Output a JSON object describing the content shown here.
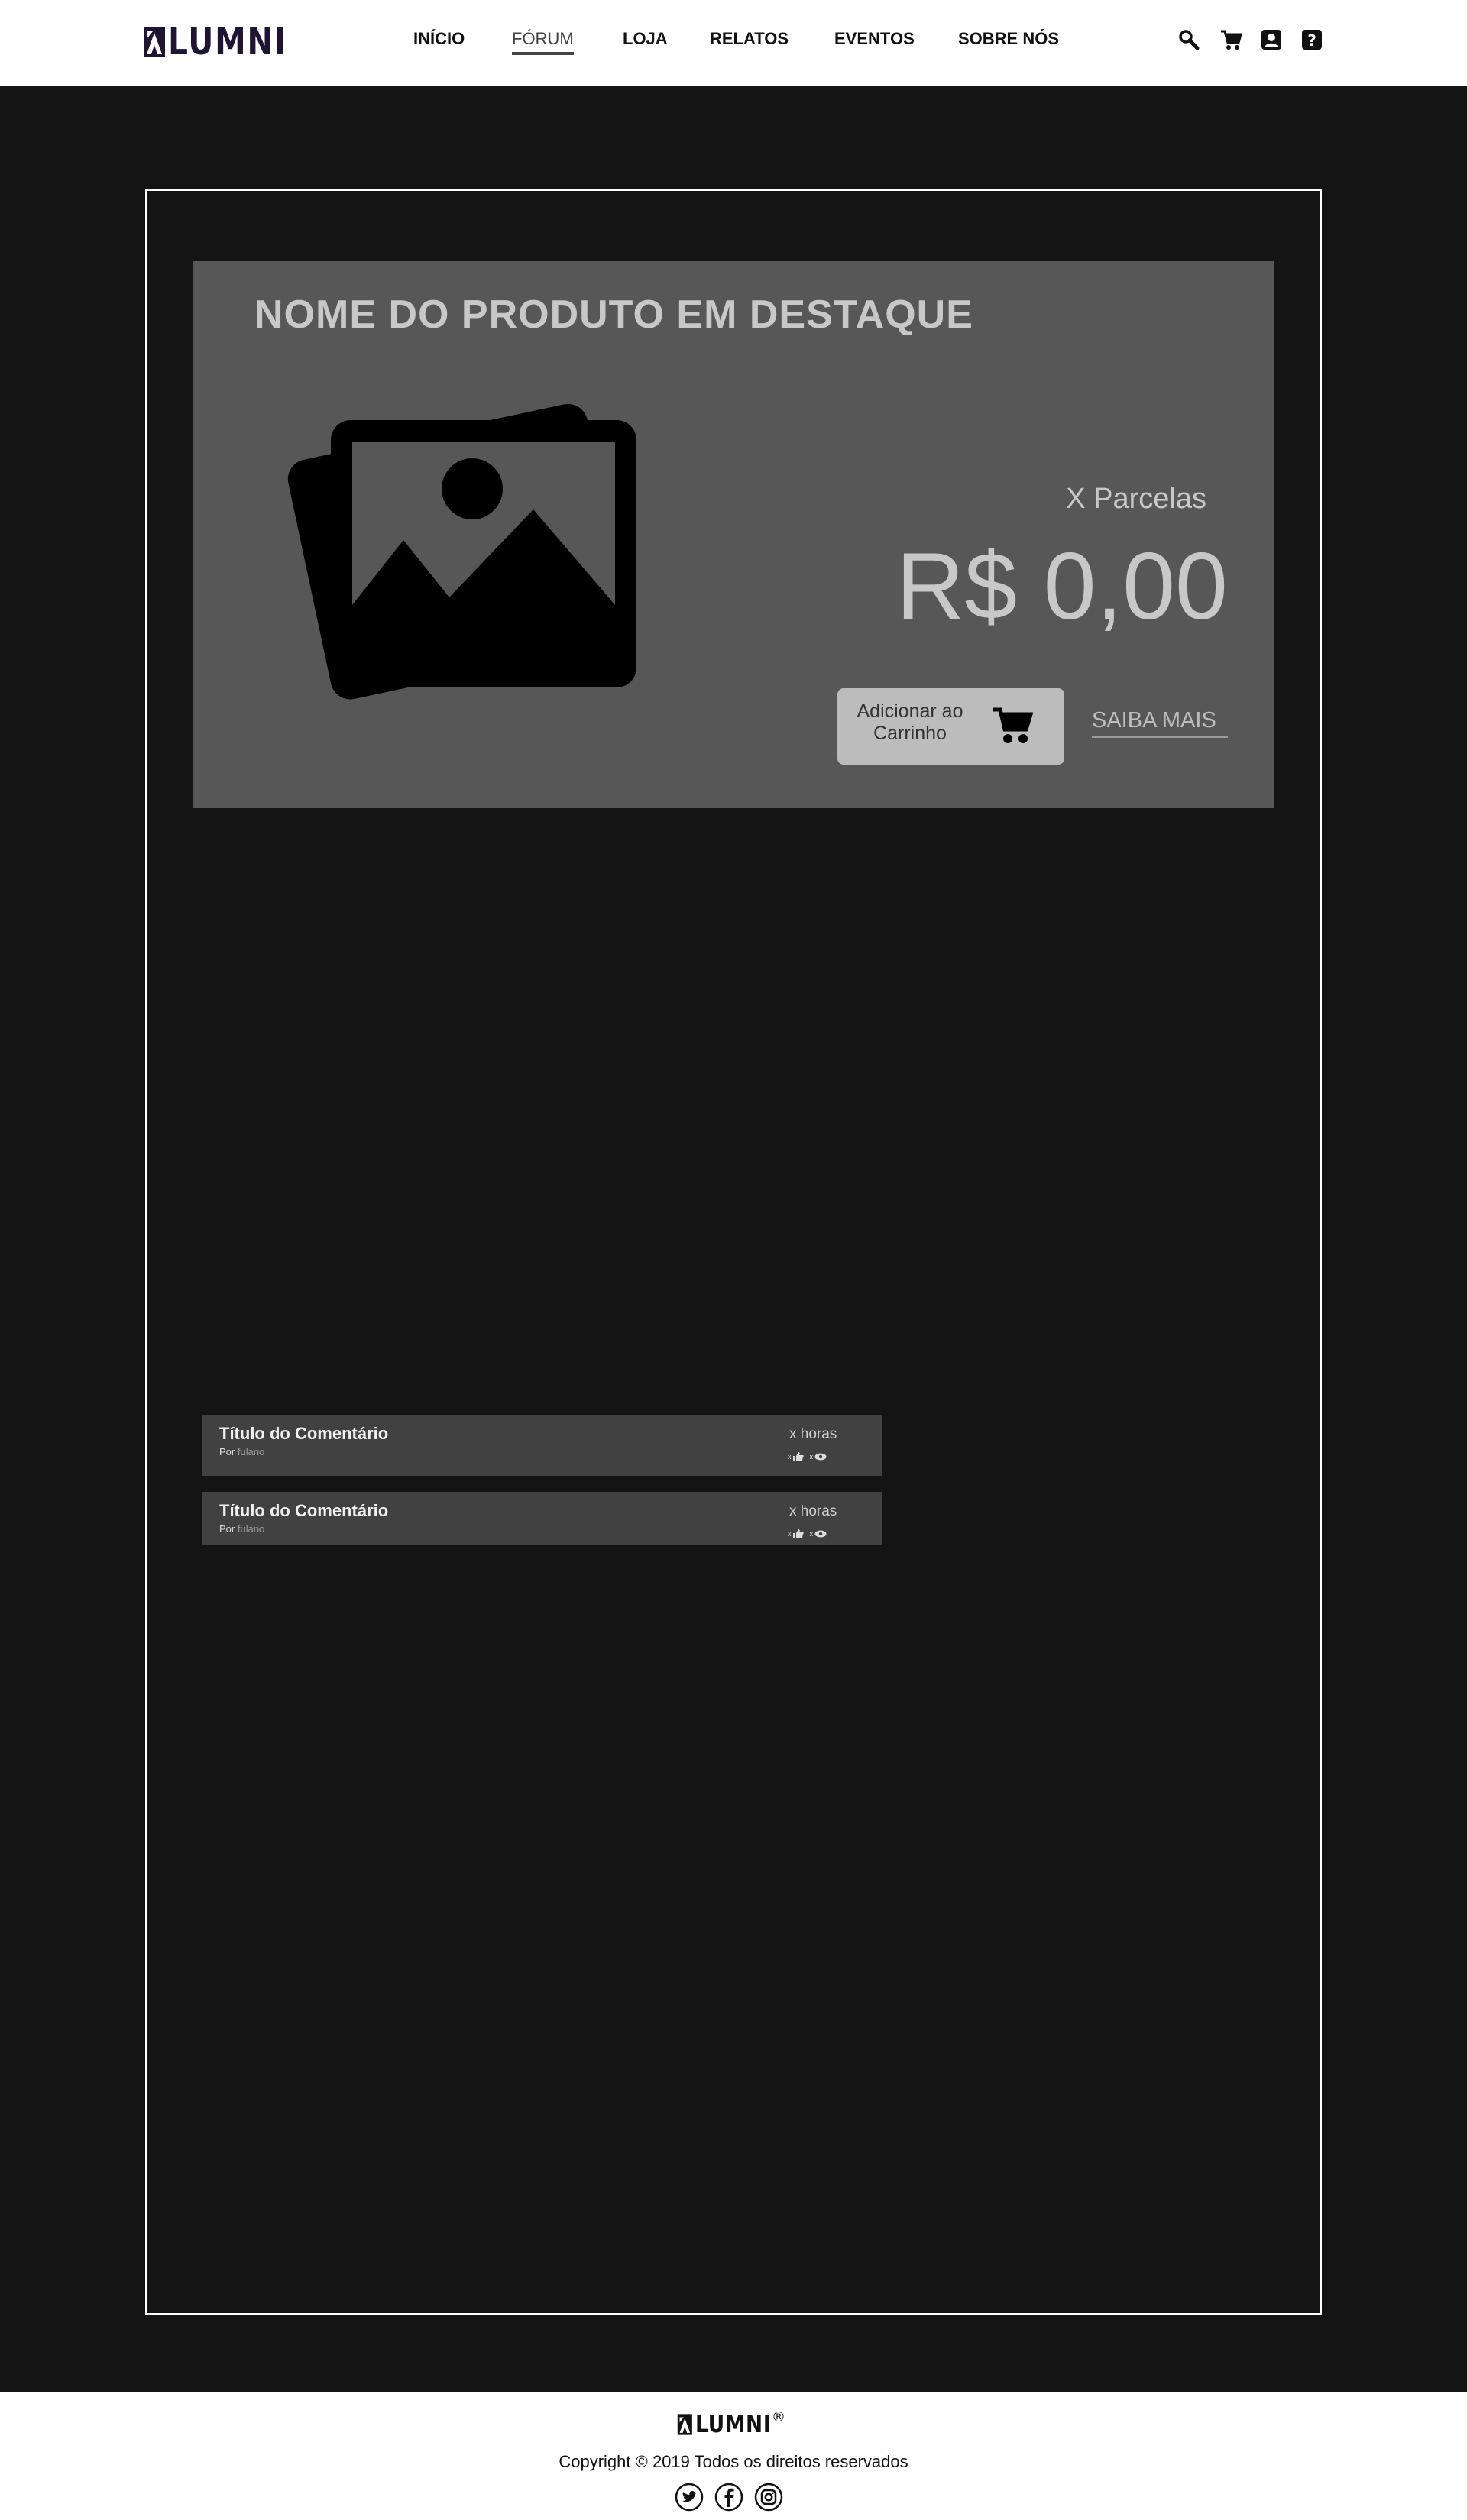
{
  "header": {
    "logo_text": "LUMNI",
    "nav": [
      {
        "label": "INÍCIO",
        "active": false
      },
      {
        "label": "FÓRUM",
        "active": true
      },
      {
        "label": "LOJA",
        "active": false
      },
      {
        "label": "RELATOS",
        "active": false
      },
      {
        "label": "EVENTOS",
        "active": false
      },
      {
        "label": "SOBRE NÓS",
        "active": false
      }
    ],
    "icons": [
      "search-icon",
      "cart-icon",
      "account-icon",
      "help-icon"
    ]
  },
  "feature": {
    "title": "NOME DO PRODUTO EM DESTAQUE",
    "image_icon": "image-placeholder-icon",
    "installments": "X Parcelas",
    "price": "R$ 0,00",
    "cart_button_label": "Adicionar ao Carrinho",
    "more_label": "SAIBA MAIS"
  },
  "comments": [
    {
      "title": "Título do Comentário",
      "by_prefix": "Por",
      "author": "fulano",
      "time": "x horas",
      "likes": "x",
      "views": "x"
    },
    {
      "title": "Título do Comentário",
      "by_prefix": "Por",
      "author": "fulano",
      "time": "x horas",
      "likes": "x",
      "views": "x"
    }
  ],
  "footer": {
    "logo_text": "LUMNI",
    "registered": "®",
    "copyright": "Copyright © 2019 Todos os direitos reservados",
    "social": [
      "twitter-icon",
      "facebook-icon",
      "instagram-icon"
    ]
  },
  "colors": {
    "page_background": "#141414",
    "feature_background": "#575757",
    "comment_background": "#414141",
    "header_background": "#ffffff",
    "logo_color": "#1e1433"
  }
}
